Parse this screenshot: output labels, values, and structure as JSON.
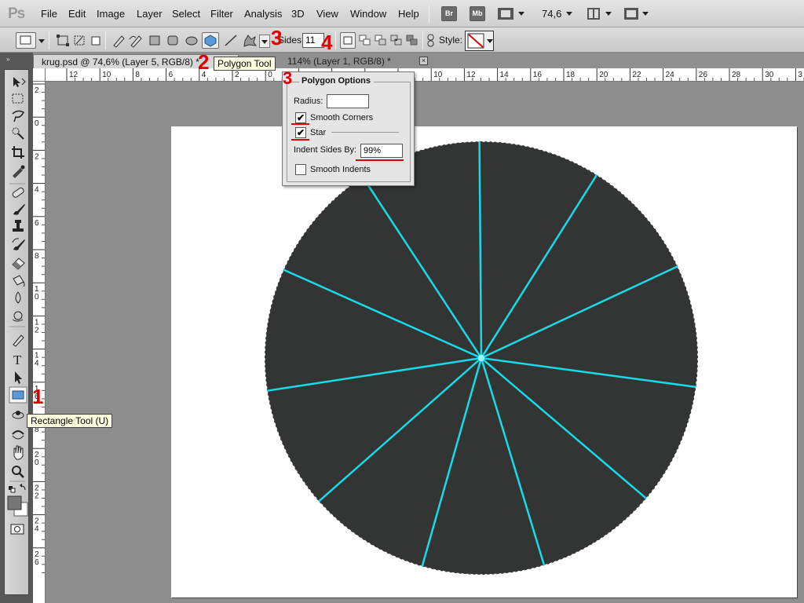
{
  "app": {
    "logo": "Ps",
    "zoom": "74,6",
    "bridge_label": "Br",
    "minibridge_label": "Mb"
  },
  "menu": [
    "File",
    "Edit",
    "Image",
    "Layer",
    "Select",
    "Filter",
    "Analysis",
    "3D",
    "View",
    "Window",
    "Help"
  ],
  "options": {
    "sides_label": "Sides:",
    "sides_value": "11",
    "style_label": "Style:"
  },
  "tabs": [
    {
      "label": "krug.psd @ 74,6% (Layer 5, RGB/8) *"
    },
    {
      "label": "114% (Layer 1, RGB/8) *"
    }
  ],
  "tooltips": {
    "polygon_tool": "Polygon Tool",
    "rectangle_tool": "Rectangle Tool (U)"
  },
  "annotations": {
    "n1": "1",
    "n2": "2",
    "n3a": "3",
    "n3b": "3",
    "n4": "4"
  },
  "polygon_options": {
    "title": "Polygon Options",
    "radius_label": "Radius:",
    "radius_value": "",
    "smooth_corners_label": "Smooth Corners",
    "smooth_corners_checked": true,
    "star_label": "Star",
    "star_checked": true,
    "indent_label": "Indent Sides By:",
    "indent_value": "99%",
    "smooth_indents_label": "Smooth Indents",
    "smooth_indents_checked": false
  },
  "ruler": {
    "h_ticks": [
      "12",
      "10",
      "8",
      "6",
      "4",
      "2",
      "0",
      "2",
      "4",
      "6",
      "8",
      "10",
      "12",
      "14",
      "16",
      "18",
      "20",
      "22",
      "24",
      "26",
      "28",
      "30",
      "3"
    ],
    "v_ticks": [
      "2",
      "0",
      "2",
      "4",
      "6",
      "8",
      "1 0",
      "1 2",
      "1 4",
      "1 6",
      "1 8",
      "2 0",
      "2 2",
      "2 4",
      "2 6"
    ]
  },
  "colors": {
    "circle_fill": "#333535",
    "ray_color": "#17dbe8",
    "annotation_red": "#e00000",
    "foreground": "#777777",
    "background": "#ffffff"
  },
  "check_mark": "✔"
}
